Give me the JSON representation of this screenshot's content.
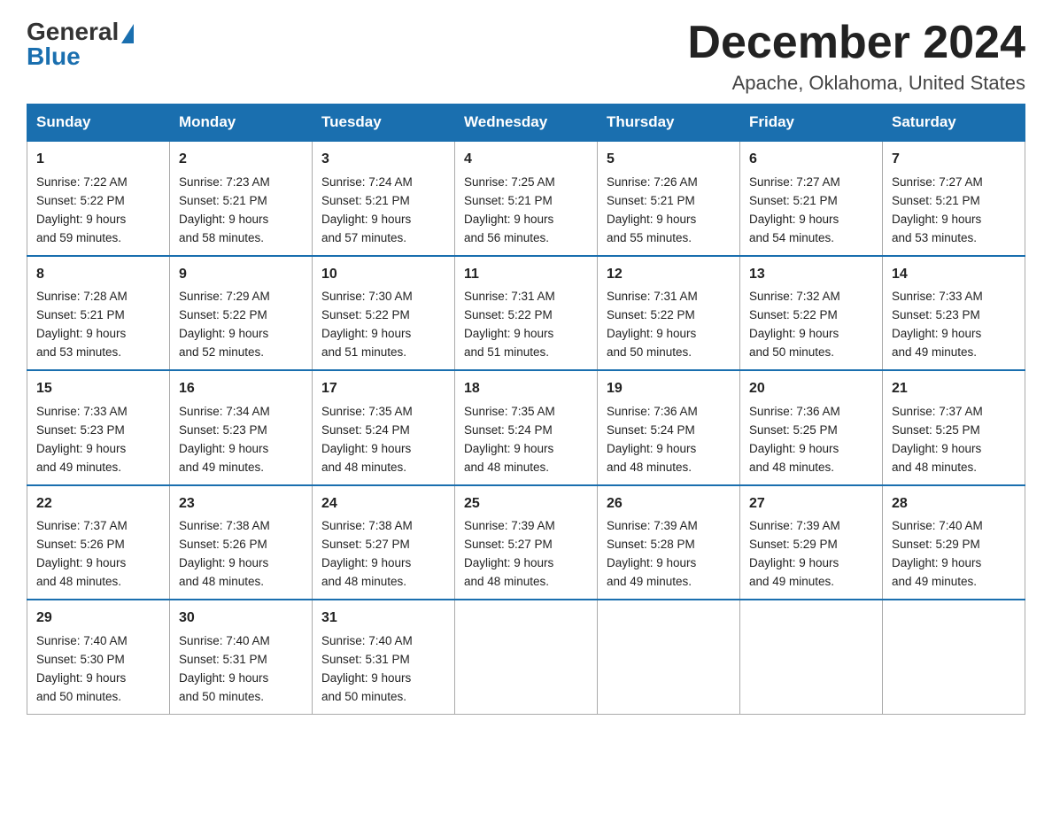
{
  "logo": {
    "general": "General",
    "blue": "Blue"
  },
  "header": {
    "month": "December 2024",
    "location": "Apache, Oklahoma, United States"
  },
  "days_of_week": [
    "Sunday",
    "Monday",
    "Tuesday",
    "Wednesday",
    "Thursday",
    "Friday",
    "Saturday"
  ],
  "weeks": [
    [
      {
        "day": "1",
        "sunrise": "7:22 AM",
        "sunset": "5:22 PM",
        "daylight": "9 hours and 59 minutes."
      },
      {
        "day": "2",
        "sunrise": "7:23 AM",
        "sunset": "5:21 PM",
        "daylight": "9 hours and 58 minutes."
      },
      {
        "day": "3",
        "sunrise": "7:24 AM",
        "sunset": "5:21 PM",
        "daylight": "9 hours and 57 minutes."
      },
      {
        "day": "4",
        "sunrise": "7:25 AM",
        "sunset": "5:21 PM",
        "daylight": "9 hours and 56 minutes."
      },
      {
        "day": "5",
        "sunrise": "7:26 AM",
        "sunset": "5:21 PM",
        "daylight": "9 hours and 55 minutes."
      },
      {
        "day": "6",
        "sunrise": "7:27 AM",
        "sunset": "5:21 PM",
        "daylight": "9 hours and 54 minutes."
      },
      {
        "day": "7",
        "sunrise": "7:27 AM",
        "sunset": "5:21 PM",
        "daylight": "9 hours and 53 minutes."
      }
    ],
    [
      {
        "day": "8",
        "sunrise": "7:28 AM",
        "sunset": "5:21 PM",
        "daylight": "9 hours and 53 minutes."
      },
      {
        "day": "9",
        "sunrise": "7:29 AM",
        "sunset": "5:22 PM",
        "daylight": "9 hours and 52 minutes."
      },
      {
        "day": "10",
        "sunrise": "7:30 AM",
        "sunset": "5:22 PM",
        "daylight": "9 hours and 51 minutes."
      },
      {
        "day": "11",
        "sunrise": "7:31 AM",
        "sunset": "5:22 PM",
        "daylight": "9 hours and 51 minutes."
      },
      {
        "day": "12",
        "sunrise": "7:31 AM",
        "sunset": "5:22 PM",
        "daylight": "9 hours and 50 minutes."
      },
      {
        "day": "13",
        "sunrise": "7:32 AM",
        "sunset": "5:22 PM",
        "daylight": "9 hours and 50 minutes."
      },
      {
        "day": "14",
        "sunrise": "7:33 AM",
        "sunset": "5:23 PM",
        "daylight": "9 hours and 49 minutes."
      }
    ],
    [
      {
        "day": "15",
        "sunrise": "7:33 AM",
        "sunset": "5:23 PM",
        "daylight": "9 hours and 49 minutes."
      },
      {
        "day": "16",
        "sunrise": "7:34 AM",
        "sunset": "5:23 PM",
        "daylight": "9 hours and 49 minutes."
      },
      {
        "day": "17",
        "sunrise": "7:35 AM",
        "sunset": "5:24 PM",
        "daylight": "9 hours and 48 minutes."
      },
      {
        "day": "18",
        "sunrise": "7:35 AM",
        "sunset": "5:24 PM",
        "daylight": "9 hours and 48 minutes."
      },
      {
        "day": "19",
        "sunrise": "7:36 AM",
        "sunset": "5:24 PM",
        "daylight": "9 hours and 48 minutes."
      },
      {
        "day": "20",
        "sunrise": "7:36 AM",
        "sunset": "5:25 PM",
        "daylight": "9 hours and 48 minutes."
      },
      {
        "day": "21",
        "sunrise": "7:37 AM",
        "sunset": "5:25 PM",
        "daylight": "9 hours and 48 minutes."
      }
    ],
    [
      {
        "day": "22",
        "sunrise": "7:37 AM",
        "sunset": "5:26 PM",
        "daylight": "9 hours and 48 minutes."
      },
      {
        "day": "23",
        "sunrise": "7:38 AM",
        "sunset": "5:26 PM",
        "daylight": "9 hours and 48 minutes."
      },
      {
        "day": "24",
        "sunrise": "7:38 AM",
        "sunset": "5:27 PM",
        "daylight": "9 hours and 48 minutes."
      },
      {
        "day": "25",
        "sunrise": "7:39 AM",
        "sunset": "5:27 PM",
        "daylight": "9 hours and 48 minutes."
      },
      {
        "day": "26",
        "sunrise": "7:39 AM",
        "sunset": "5:28 PM",
        "daylight": "9 hours and 49 minutes."
      },
      {
        "day": "27",
        "sunrise": "7:39 AM",
        "sunset": "5:29 PM",
        "daylight": "9 hours and 49 minutes."
      },
      {
        "day": "28",
        "sunrise": "7:40 AM",
        "sunset": "5:29 PM",
        "daylight": "9 hours and 49 minutes."
      }
    ],
    [
      {
        "day": "29",
        "sunrise": "7:40 AM",
        "sunset": "5:30 PM",
        "daylight": "9 hours and 50 minutes."
      },
      {
        "day": "30",
        "sunrise": "7:40 AM",
        "sunset": "5:31 PM",
        "daylight": "9 hours and 50 minutes."
      },
      {
        "day": "31",
        "sunrise": "7:40 AM",
        "sunset": "5:31 PM",
        "daylight": "9 hours and 50 minutes."
      },
      null,
      null,
      null,
      null
    ]
  ],
  "labels": {
    "sunrise": "Sunrise:",
    "sunset": "Sunset:",
    "daylight": "Daylight:"
  }
}
